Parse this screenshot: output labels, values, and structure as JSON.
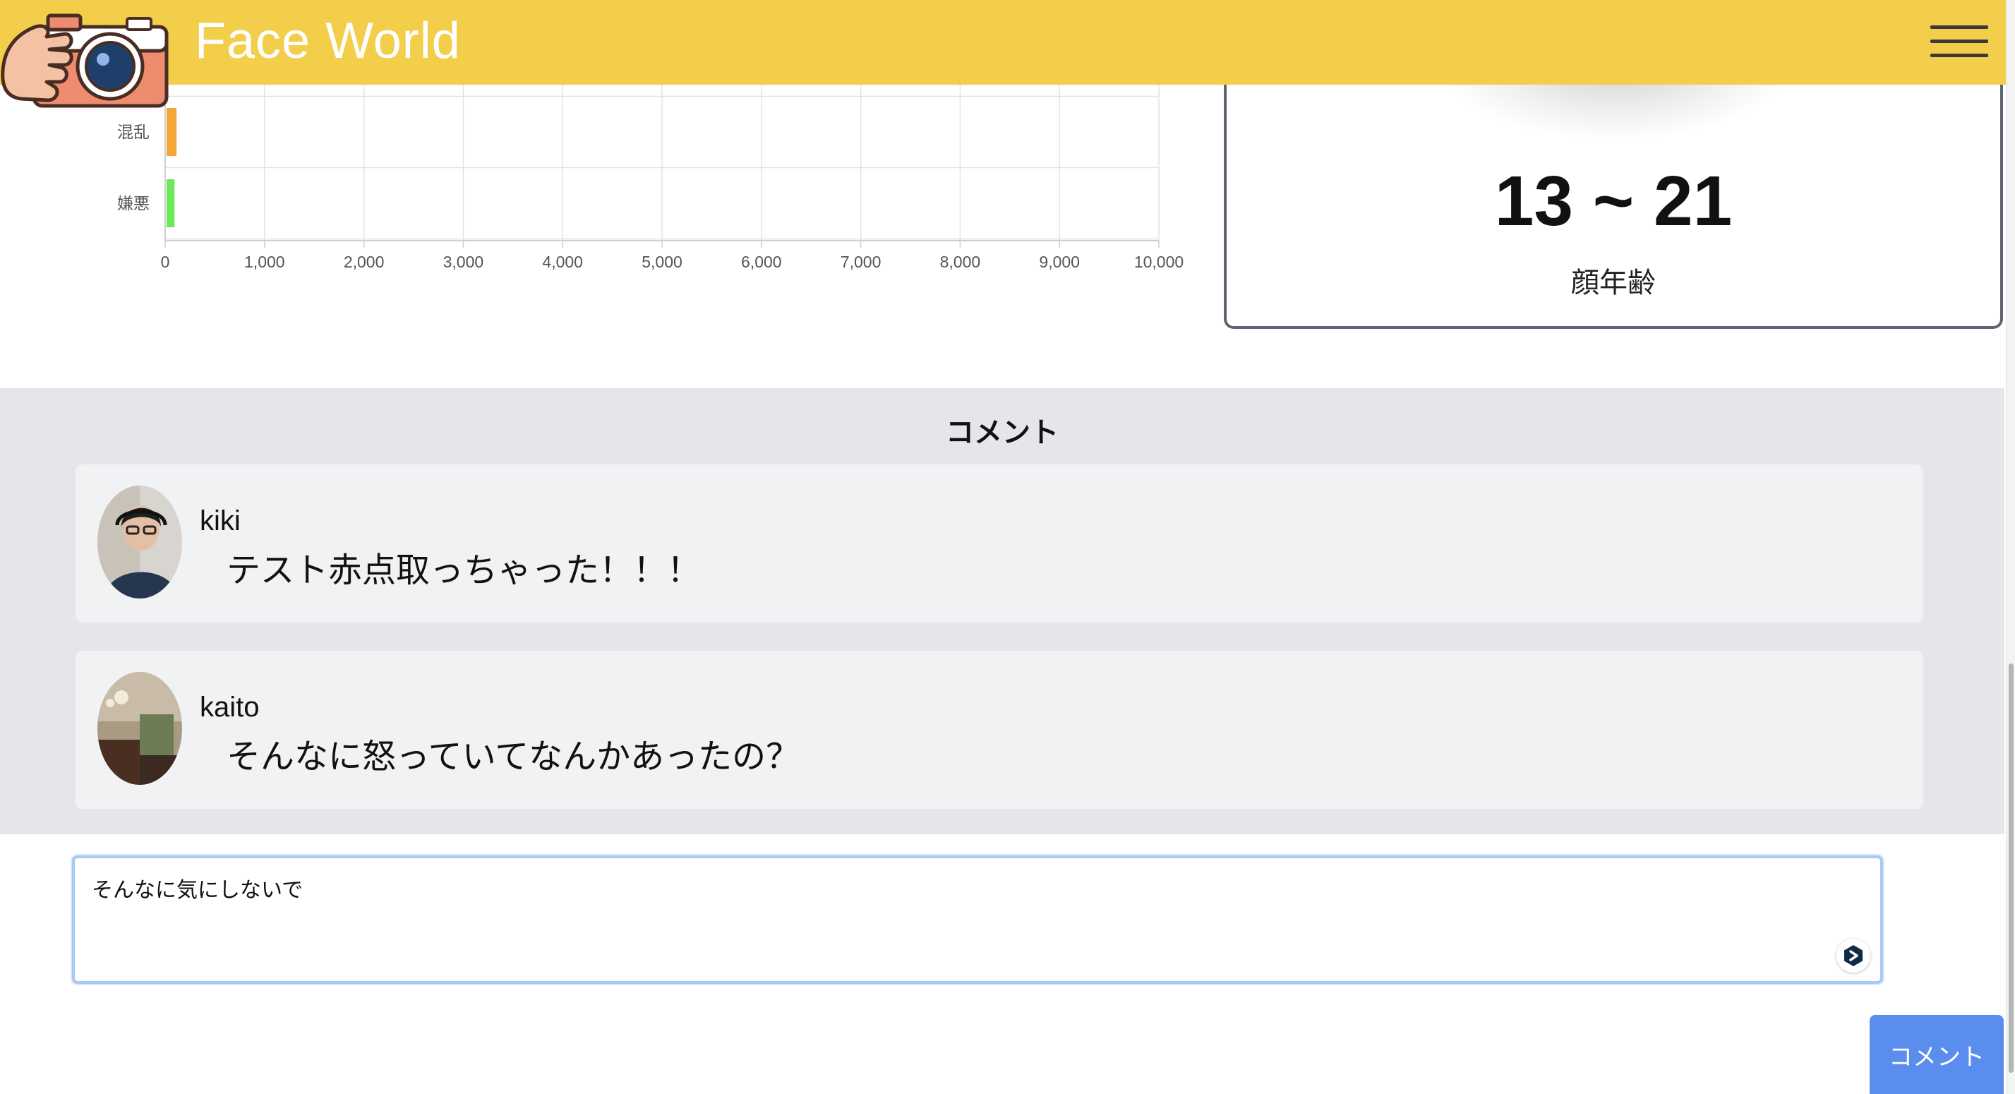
{
  "header": {
    "app_title": "Face World",
    "logo_icon": "camera-icon",
    "menu_icon": "hamburger-menu-icon"
  },
  "chart_data": {
    "type": "bar",
    "orientation": "horizontal",
    "categories": [
      "混乱",
      "嫌悪"
    ],
    "values": [
      100,
      80
    ],
    "colors": [
      "#f3a73b",
      "#6de85a"
    ],
    "xlim": [
      0,
      10000
    ],
    "xticks": [
      "0",
      "1,000",
      "2,000",
      "3,000",
      "4,000",
      "5,000",
      "6,000",
      "7,000",
      "8,000",
      "9,000",
      "10,000"
    ],
    "grid": true
  },
  "age_card": {
    "range": "13 ~ 21",
    "label": "顔年齢"
  },
  "comments": {
    "title": "コメント",
    "items": [
      {
        "user": "kiki",
        "text": "テスト赤点取っちゃった！！！"
      },
      {
        "user": "kaito",
        "text": "そんなに怒っていてなんかあったの？"
      }
    ]
  },
  "comment_form": {
    "value": "そんなに気にしないで",
    "submit_label": "コメント",
    "assist_icon": "deepl-translate-icon"
  }
}
